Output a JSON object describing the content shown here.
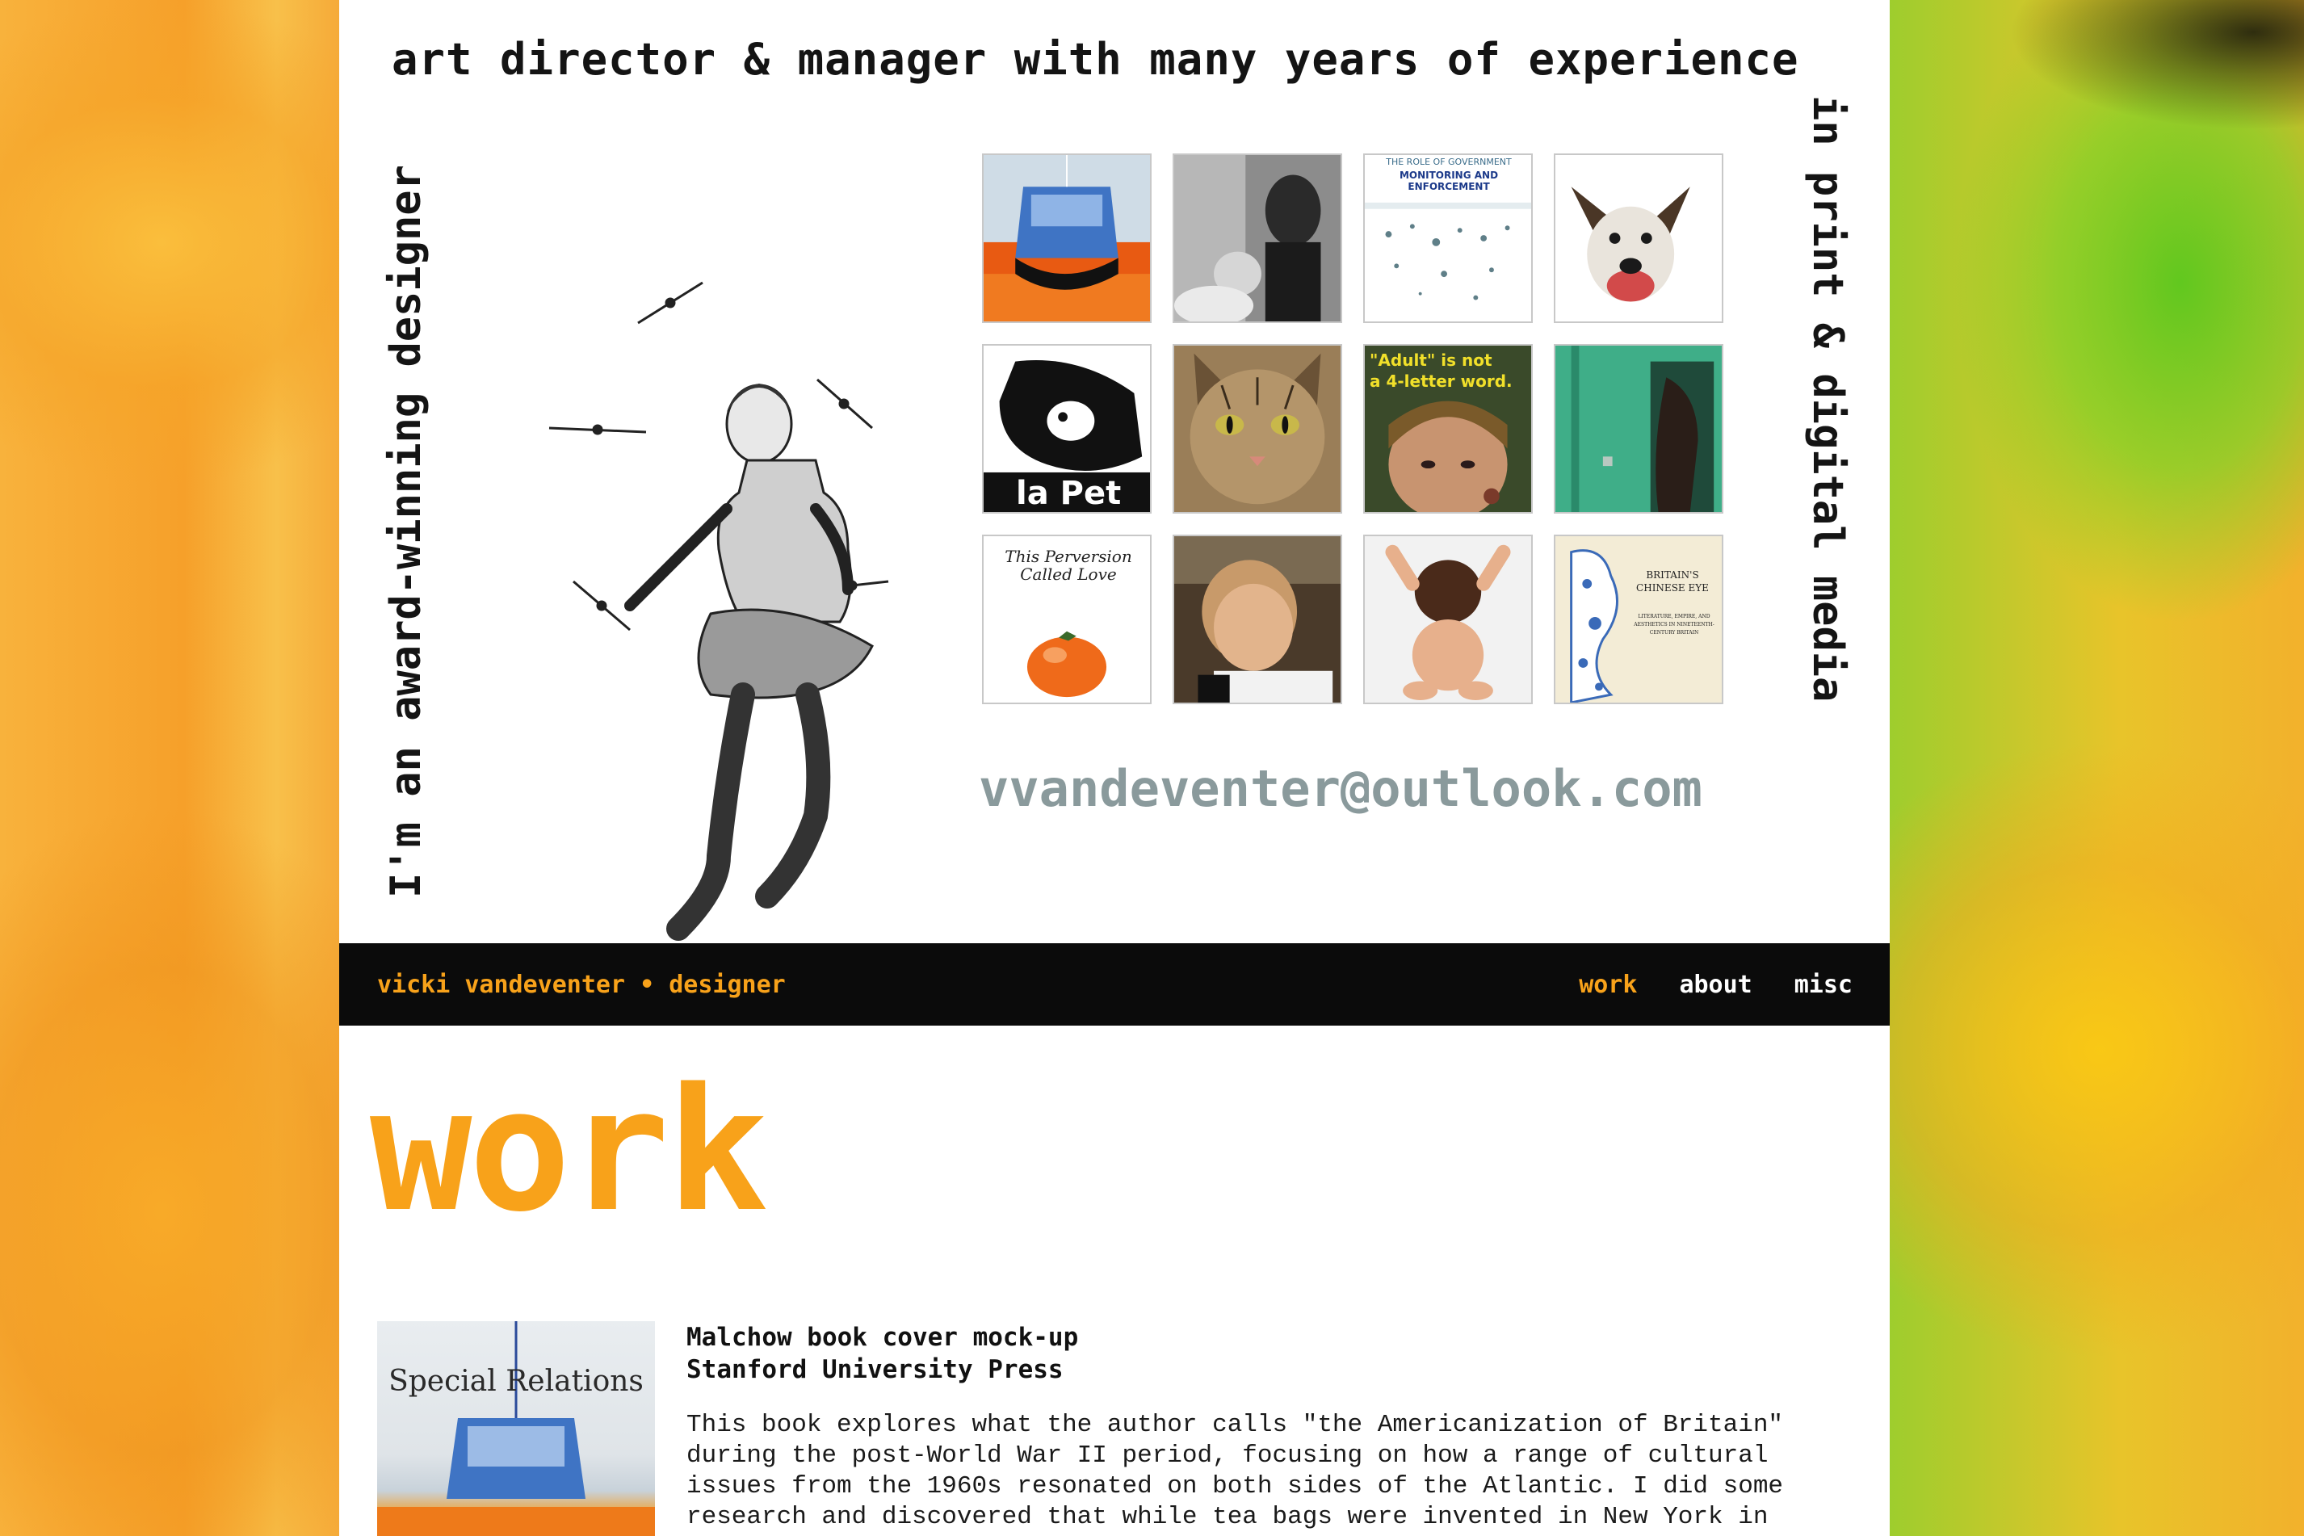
{
  "hero": {
    "tagline_top": "art director & manager with many years of experience",
    "tagline_left": "I'm an award-winning designer",
    "tagline_right": "in print & digital media",
    "email": "vvandeventer@outlook.com",
    "thumbnails": [
      {
        "caption": ""
      },
      {
        "caption": ""
      },
      {
        "caption": "THE ROLE OF GOVERNMENT",
        "caption2": "MONITORING AND ENFORCEMENT"
      },
      {
        "caption": ""
      },
      {
        "caption": "la Pet"
      },
      {
        "caption": ""
      },
      {
        "caption": "\"Adult\" is not",
        "caption2": "a 4-letter word."
      },
      {
        "caption": ""
      },
      {
        "caption": "This Perversion Called Love"
      },
      {
        "caption": ""
      },
      {
        "caption": ""
      },
      {
        "caption": "BRITAIN'S CHINESE EYE",
        "caption2": "LITERATURE, EMPIRE, AND AESTHETICS IN NINETEENTH-CENTURY BRITAIN"
      }
    ]
  },
  "nav": {
    "brand": "vicki vandeventer • designer",
    "links": [
      {
        "label": "work",
        "active": true
      },
      {
        "label": "about",
        "active": false
      },
      {
        "label": "misc",
        "active": false
      }
    ]
  },
  "main": {
    "heading": "work",
    "project": {
      "cover_title": "Special Relations",
      "title": "Malchow book cover mock-up",
      "subtitle": "Stanford University Press",
      "description": "This book explores what the author calls \"the Americanization of Britain\" during the post-World War II period, focusing on how a range of cultural issues from the 1960s resonated on both sides of the Atlantic. I did some research and discovered that while tea bags were invented in New York in"
    }
  },
  "colors": {
    "accent": "#f8a21a",
    "nav_bg": "#0b0b0b",
    "email": "#8a9a9c"
  }
}
